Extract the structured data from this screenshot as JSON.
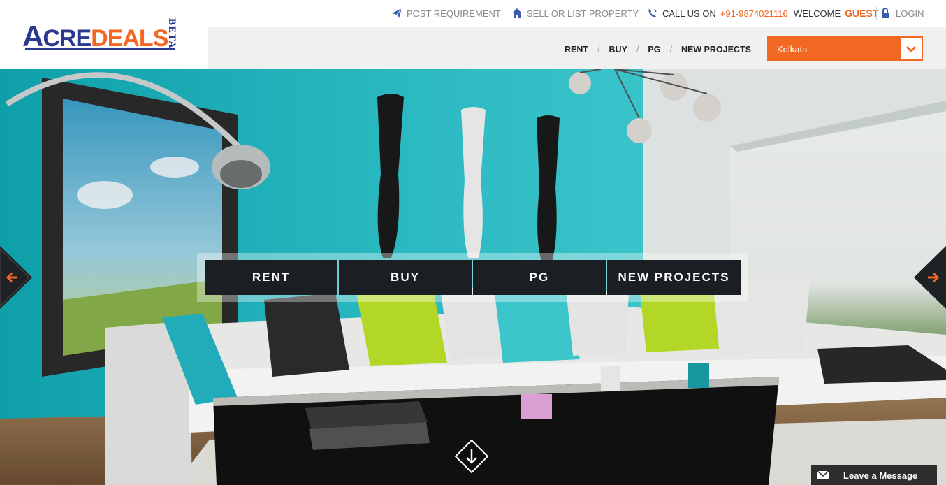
{
  "brand": {
    "logo_text_a": "A",
    "logo_text_cre": "CRE",
    "logo_text_deals": "DEALS",
    "beta": "BETA",
    "primary_color": "#2b3a8f",
    "accent_color": "#f26722"
  },
  "topbar": {
    "post_requirement": "POST REQUIREMENT",
    "sell_or_list": "SELL OR LIST PROPERTY",
    "call_us": "CALL US ON",
    "phone": "+91-9874021116",
    "welcome": "WELCOME",
    "guest": "GUEST",
    "login": "LOGIN"
  },
  "nav": {
    "rent": "RENT",
    "buy": "BUY",
    "pg": "PG",
    "new_projects": "NEW PROJECTS",
    "separator": "/"
  },
  "city_select": {
    "value": "Kolkata"
  },
  "hero_tabs": {
    "rent": "RENT",
    "buy": "BUY",
    "pg": "PG",
    "new_projects": "NEW PROJECTS"
  },
  "chat": {
    "label": "Leave a Message"
  },
  "icons": {
    "post": "paper-plane-icon",
    "sell": "home-icon",
    "call": "phone-icon",
    "login": "lock-icon",
    "city": "chevron-down-icon",
    "prev": "arrow-left-icon",
    "next": "arrow-right-icon",
    "scroll": "arrow-down-icon",
    "chat": "envelope-icon"
  }
}
